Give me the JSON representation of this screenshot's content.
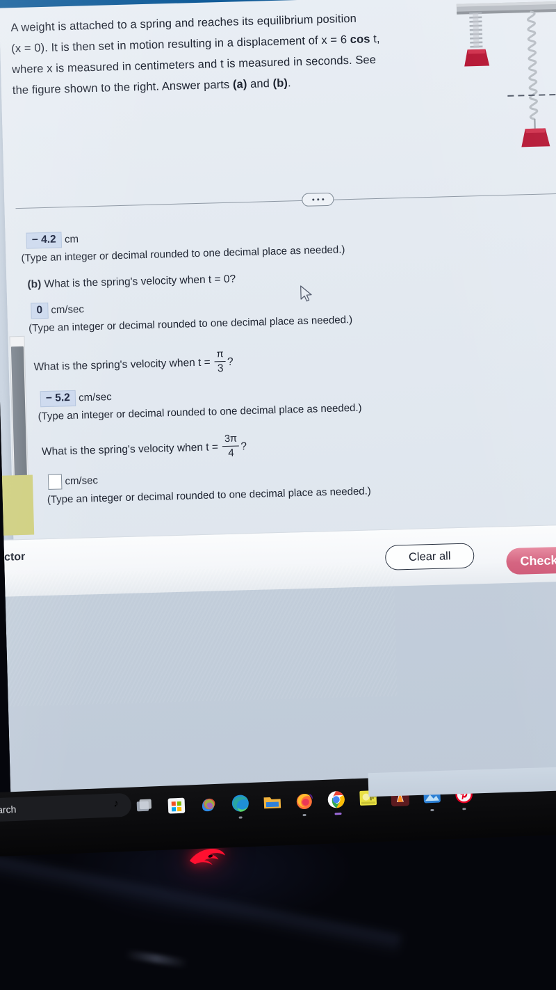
{
  "app": {
    "top_band_color": "#125e9c",
    "panel_bg": "#e6ecf3",
    "accent_check": "#d4627f"
  },
  "problem": {
    "stem_line1": "A weight is attached to a spring and reaches its equilibrium position",
    "stem_line2_a": "(x = 0). It is then set in motion resulting in a displacement of ",
    "stem_line2_eq": "x = 6 ",
    "stem_line2_cos": "cos",
    "stem_line2_t": " t,",
    "stem_line3": "where x is measured in centimeters and t is measured in seconds. See",
    "stem_line4_a": "the figure shown to the right. Answer parts ",
    "stem_part_a": "(a)",
    "stem_and": " and ",
    "stem_part_b": "(b)",
    "stem_line4_end": "."
  },
  "divider": {
    "dots_label": "•••"
  },
  "answers": [
    {
      "id": "answer-a-displacement",
      "value": "− 4.2",
      "unit": "cm",
      "empty": false,
      "hint": "(Type an integer or decimal rounded to one decimal place as needed.)"
    },
    {
      "id": "answer-b-velocity-t0",
      "question_prefix": "(b)",
      "question_text": "What is the spring's velocity when t = 0?",
      "value": "0",
      "unit": "cm/sec",
      "empty": false,
      "hint": "(Type an integer or decimal rounded to one decimal place as needed.)"
    },
    {
      "id": "answer-velocity-pi-over-3",
      "question_text": "What is the spring's velocity when t =",
      "fraction_numerator": "π",
      "fraction_denominator": "3",
      "question_suffix": "?",
      "value": "− 5.2",
      "unit": "cm/sec",
      "empty": false,
      "hint": "(Type an integer or decimal rounded to one decimal place as needed.)"
    },
    {
      "id": "answer-velocity-3pi-over-4",
      "question_text": "What is the spring's velocity when t =",
      "fraction_numerator": "3π",
      "fraction_denominator": "4",
      "question_suffix": "?",
      "value": "",
      "unit": "cm/sec",
      "empty": true,
      "hint": "(Type an integer or decimal rounded to one decimal place as needed.)"
    }
  ],
  "footer": {
    "left_label": "ctor",
    "clear_all": "Clear all",
    "check": "Check"
  },
  "figure": {
    "caption": "spring-weight-equilibrium-diagram",
    "bar_color": "#a8adb4",
    "weight_color": "#b01030",
    "spring_color": "#cfd4da"
  },
  "taskbar": {
    "search_placeholder": "Search",
    "search_emoji": "♪",
    "icons": [
      {
        "name": "task-view-icon",
        "label": "Task view"
      },
      {
        "name": "microsoft-store-icon",
        "label": "Microsoft Store"
      },
      {
        "name": "copilot-icon",
        "label": "Copilot"
      },
      {
        "name": "microsoft-edge-icon",
        "label": "Microsoft Edge"
      },
      {
        "name": "file-explorer-icon",
        "label": "File Explorer"
      },
      {
        "name": "firefox-icon",
        "label": "Firefox"
      },
      {
        "name": "google-chrome-icon",
        "label": "Google Chrome"
      },
      {
        "name": "media-player-icon",
        "label": "Player"
      },
      {
        "name": "vlc-media-player-icon",
        "label": "VLC media player"
      },
      {
        "name": "photos-icon",
        "label": "Photos"
      },
      {
        "name": "pinterest-icon",
        "label": "Pinterest"
      }
    ]
  },
  "device": {
    "brand_logo": "rog-logo"
  }
}
